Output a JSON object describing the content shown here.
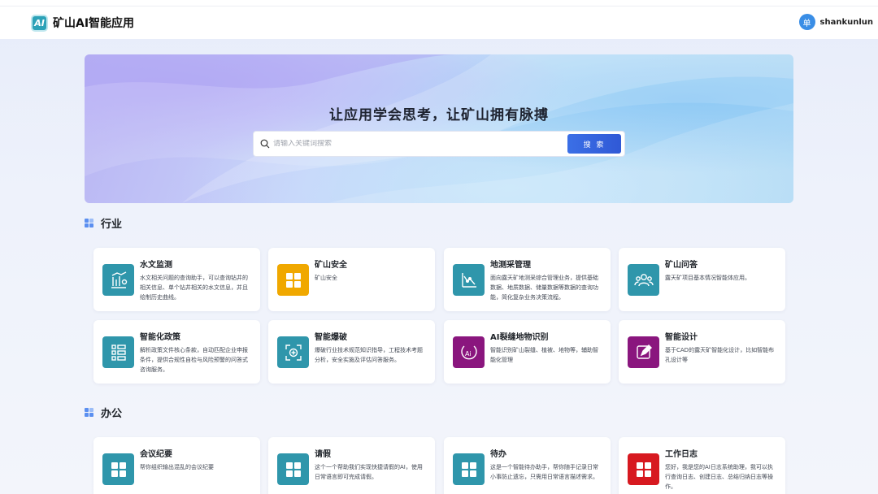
{
  "header": {
    "logo_text": "AI",
    "brand": "矿山AI智能应用",
    "avatar_char": "单",
    "username": "shankunlun"
  },
  "hero": {
    "title": "让应用学会思考，让矿山拥有脉搏",
    "search_placeholder": "请输入关键词搜索",
    "search_button": "搜 索"
  },
  "sections": {
    "industry": "行业",
    "office": "办公"
  },
  "colors": {
    "teal": "#2f96ab",
    "amber": "#f0a800",
    "purple": "#8a167e",
    "red": "#d71920",
    "accent": "#3b6fe6"
  },
  "industry_cards": [
    {
      "title": "水文监测",
      "desc": "水文相关问题的查询助手，可以查询钻井的相关信息、单个钻井相关的水文信息，并且绘制历史曲线。",
      "icon": "hydrology-chart-icon"
    },
    {
      "title": "矿山安全",
      "desc": "矿山安全",
      "icon": "grid-app-icon"
    },
    {
      "title": "地测采管理",
      "desc": "面向露天矿地测采综合管理业务，提供基础数据、地质数据、储量数据等数据的查询功能，简化复杂业务决策流程。",
      "icon": "survey-chart-icon"
    },
    {
      "title": "矿山问答",
      "desc": "露天矿项目基本情况智能体应用。",
      "icon": "team-people-icon"
    },
    {
      "title": "智能化政策",
      "desc": "解析政策文件核心条款，自动匹配企业申报条件，提供合规性自检与风险预警的问答式咨询服务。",
      "icon": "policy-list-icon"
    },
    {
      "title": "智能爆破",
      "desc": "爆破行业技术规范知识指导，工程技术考题分析，安全实施及评估问答服务。",
      "icon": "blast-target-icon"
    },
    {
      "title": "AI裂缝地物识别",
      "desc": "智能识别矿山裂缝、植被、地物等，辅助智能化管理",
      "icon": "ai-recognition-icon"
    },
    {
      "title": "智能设计",
      "desc": "基于CAD的露天矿智能化设计，比如智能布孔设计等",
      "icon": "design-edit-icon"
    }
  ],
  "office_cards": [
    {
      "title": "会议纪要",
      "desc": "帮你组织输出混乱的会议纪要",
      "icon": "grid-app-icon"
    },
    {
      "title": "请假",
      "desc": "这个一个帮助我们实现快捷请假的AI，使用日常语言即可完成请假。",
      "icon": "grid-app-icon"
    },
    {
      "title": "待办",
      "desc": "这是一个智能待办助手，帮你随手记录日常小事防止遗忘，只需用日常语言描述需求。",
      "icon": "grid-app-icon"
    },
    {
      "title": "工作日志",
      "desc": "您好，我是您的AI日志系统助理，我可以执行查询日志、创建日志、总结归纳日志等操作。",
      "icon": "grid-app-icon"
    }
  ]
}
